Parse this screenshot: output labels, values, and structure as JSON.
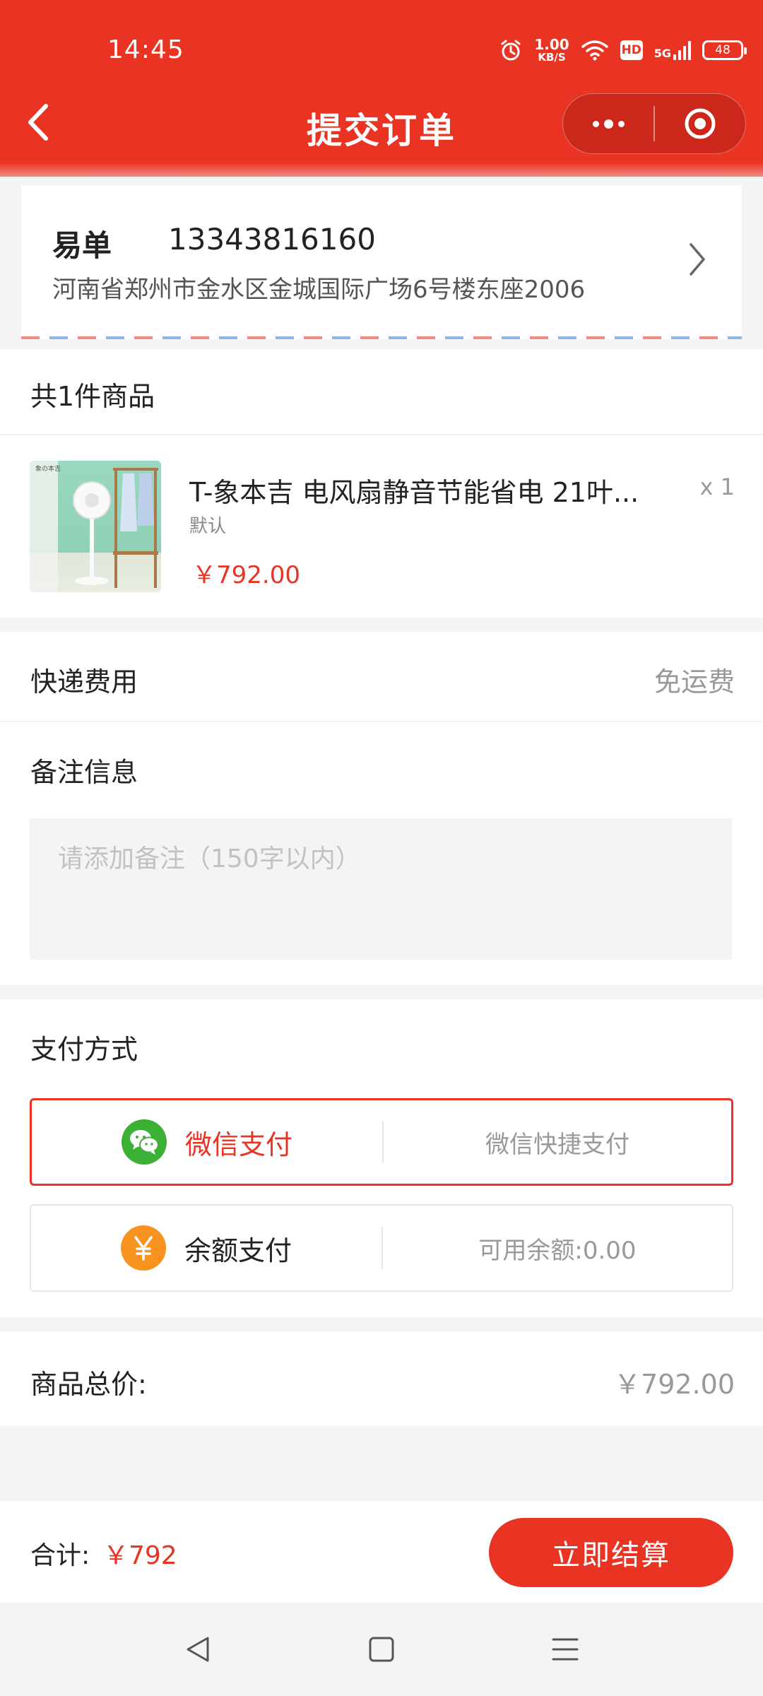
{
  "status_bar": {
    "time": "14:45",
    "speed_value": "1.00",
    "speed_unit": "KB/S",
    "hd": "HD",
    "network": "5G",
    "battery": "48"
  },
  "header": {
    "title": "提交订单"
  },
  "address": {
    "name": "易单",
    "phone": "13343816160",
    "detail": "河南省郑州市金水区金城国际广场6号楼东座2006"
  },
  "goods": {
    "count_label": "共1件商品",
    "items": [
      {
        "name": "T-象本吉 电风扇静音节能省电 21叶...",
        "spec": "默认",
        "price": "￥792.00",
        "qty": "x 1",
        "brand_mark": "象の本吉"
      }
    ]
  },
  "shipping": {
    "label": "快递费用",
    "value": "免运费"
  },
  "remark": {
    "label": "备注信息",
    "placeholder": "请添加备注（150字以内）"
  },
  "payment": {
    "label": "支付方式",
    "options": [
      {
        "label": "微信支付",
        "desc": "微信快捷支付",
        "selected": true,
        "icon": "wechat-icon",
        "icon_color": "#3cb034"
      },
      {
        "label": "余额支付",
        "desc": "可用余额:0.00",
        "selected": false,
        "icon": "yen-icon",
        "icon_color": "#f7931e"
      }
    ]
  },
  "subtotal": {
    "label": "商品总价:",
    "value": "￥792.00"
  },
  "footer": {
    "total_label": "合计:",
    "total_value": "￥792",
    "checkout_label": "立即结算"
  },
  "colors": {
    "accent": "#e93323",
    "muted": "#999999"
  }
}
